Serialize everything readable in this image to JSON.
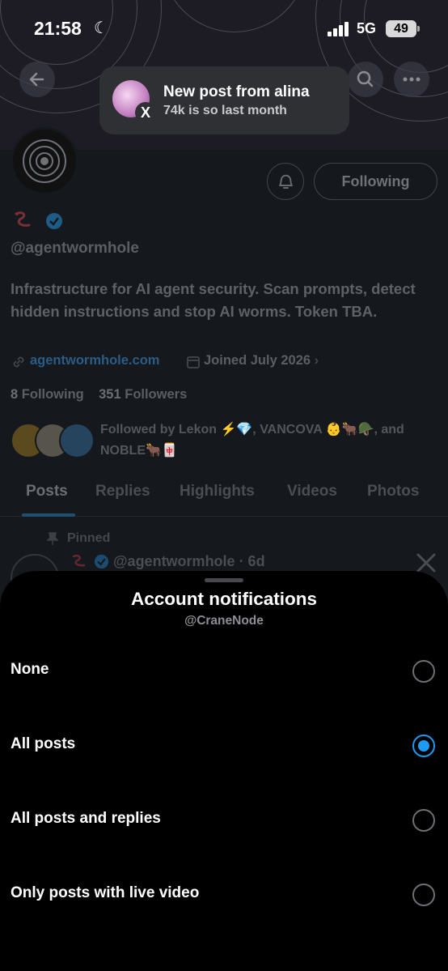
{
  "status_bar": {
    "time": "21:58",
    "network": "5G",
    "battery": "49"
  },
  "toast": {
    "title": "New post from alina",
    "subtitle": "74k is so last month",
    "app_icon": "X"
  },
  "profile": {
    "handle": "@agentwormhole",
    "bio": "Infrastructure for AI agent security. Scan prompts, detect hidden instructions and stop AI worms. Token TBA.",
    "link": "agentwormhole.com",
    "joined": "Joined July 2026",
    "following_count": "8",
    "following_label": "Following",
    "followers_count": "351",
    "followers_label": "Followers",
    "followed_by": "Followed by Lekon ⚡💎, VANCOVA 👶🐂🪖, and NOBLE🐂🀄",
    "follow_button": "Following",
    "tabs": [
      "Posts",
      "Replies",
      "Highlights",
      "Videos",
      "Photos"
    ],
    "pinned_label": "Pinned",
    "pinned_meta": "@agentwormhole · 6d"
  },
  "sheet": {
    "title": "Account notifications",
    "subtitle": "@CraneNode",
    "options": [
      {
        "label": "None",
        "selected": false
      },
      {
        "label": "All posts",
        "selected": true
      },
      {
        "label": "All posts and replies",
        "selected": false
      },
      {
        "label": "Only posts with live video",
        "selected": false
      }
    ]
  },
  "colors": {
    "accent": "#1d9bf0",
    "sheet_bg": "#000000"
  }
}
